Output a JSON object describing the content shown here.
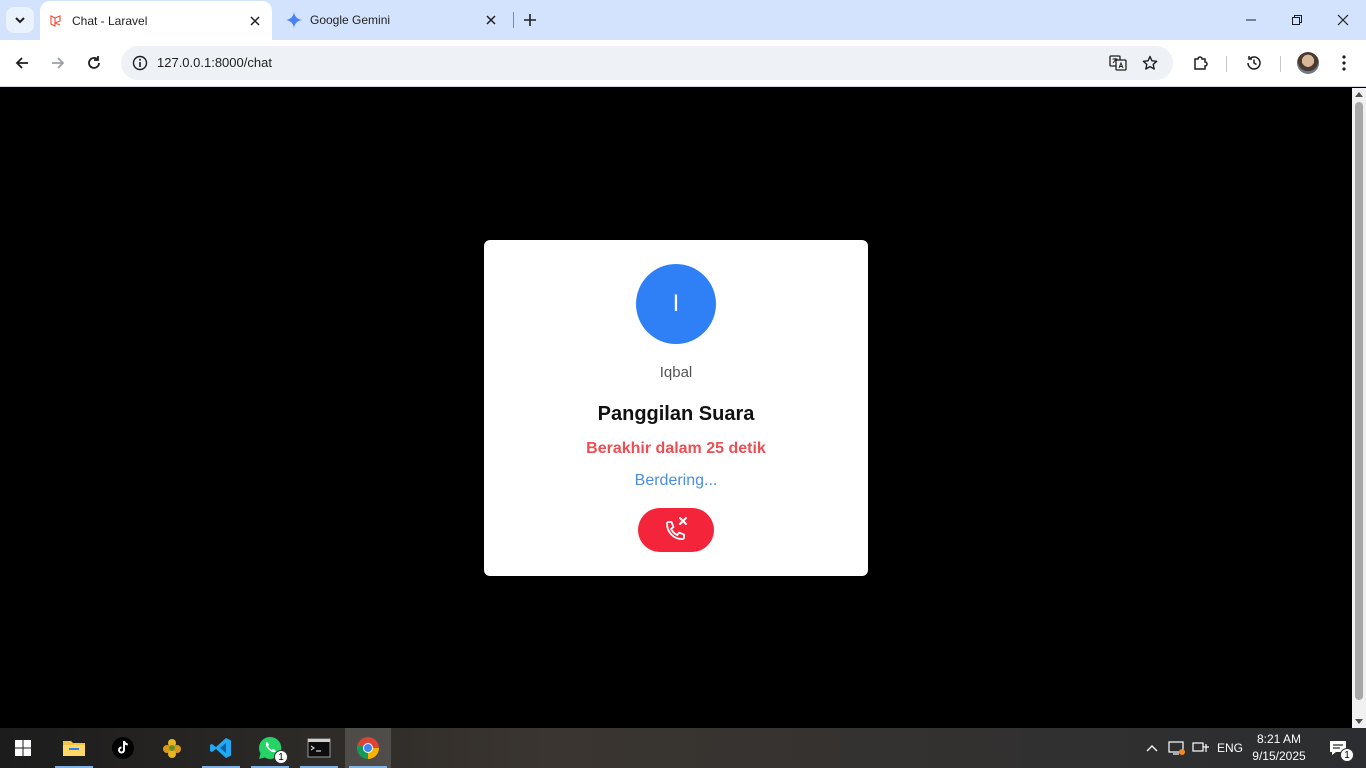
{
  "browser": {
    "tabs": [
      {
        "title": "Chat - Laravel",
        "active": true
      },
      {
        "title": "Google Gemini",
        "active": false
      }
    ],
    "url": "127.0.0.1:8000/chat"
  },
  "call": {
    "avatar_initial": "I",
    "caller_name": "Iqbal",
    "call_type": "Panggilan Suara",
    "countdown": "Berakhir dalam 25 detik",
    "status": "Berdering..."
  },
  "taskbar": {
    "apps": [
      "file-explorer",
      "tiktok",
      "app-flower",
      "vscode",
      "whatsapp",
      "terminal",
      "chrome"
    ],
    "whatsapp_badge": "1",
    "language": "ENG",
    "time": "8:21 AM",
    "date": "9/15/2025",
    "notification_count": "1"
  },
  "colors": {
    "avatar": "#2f7ff6",
    "countdown": "#ec4f53",
    "status": "#4a8ee0",
    "end_call": "#f4253a"
  }
}
